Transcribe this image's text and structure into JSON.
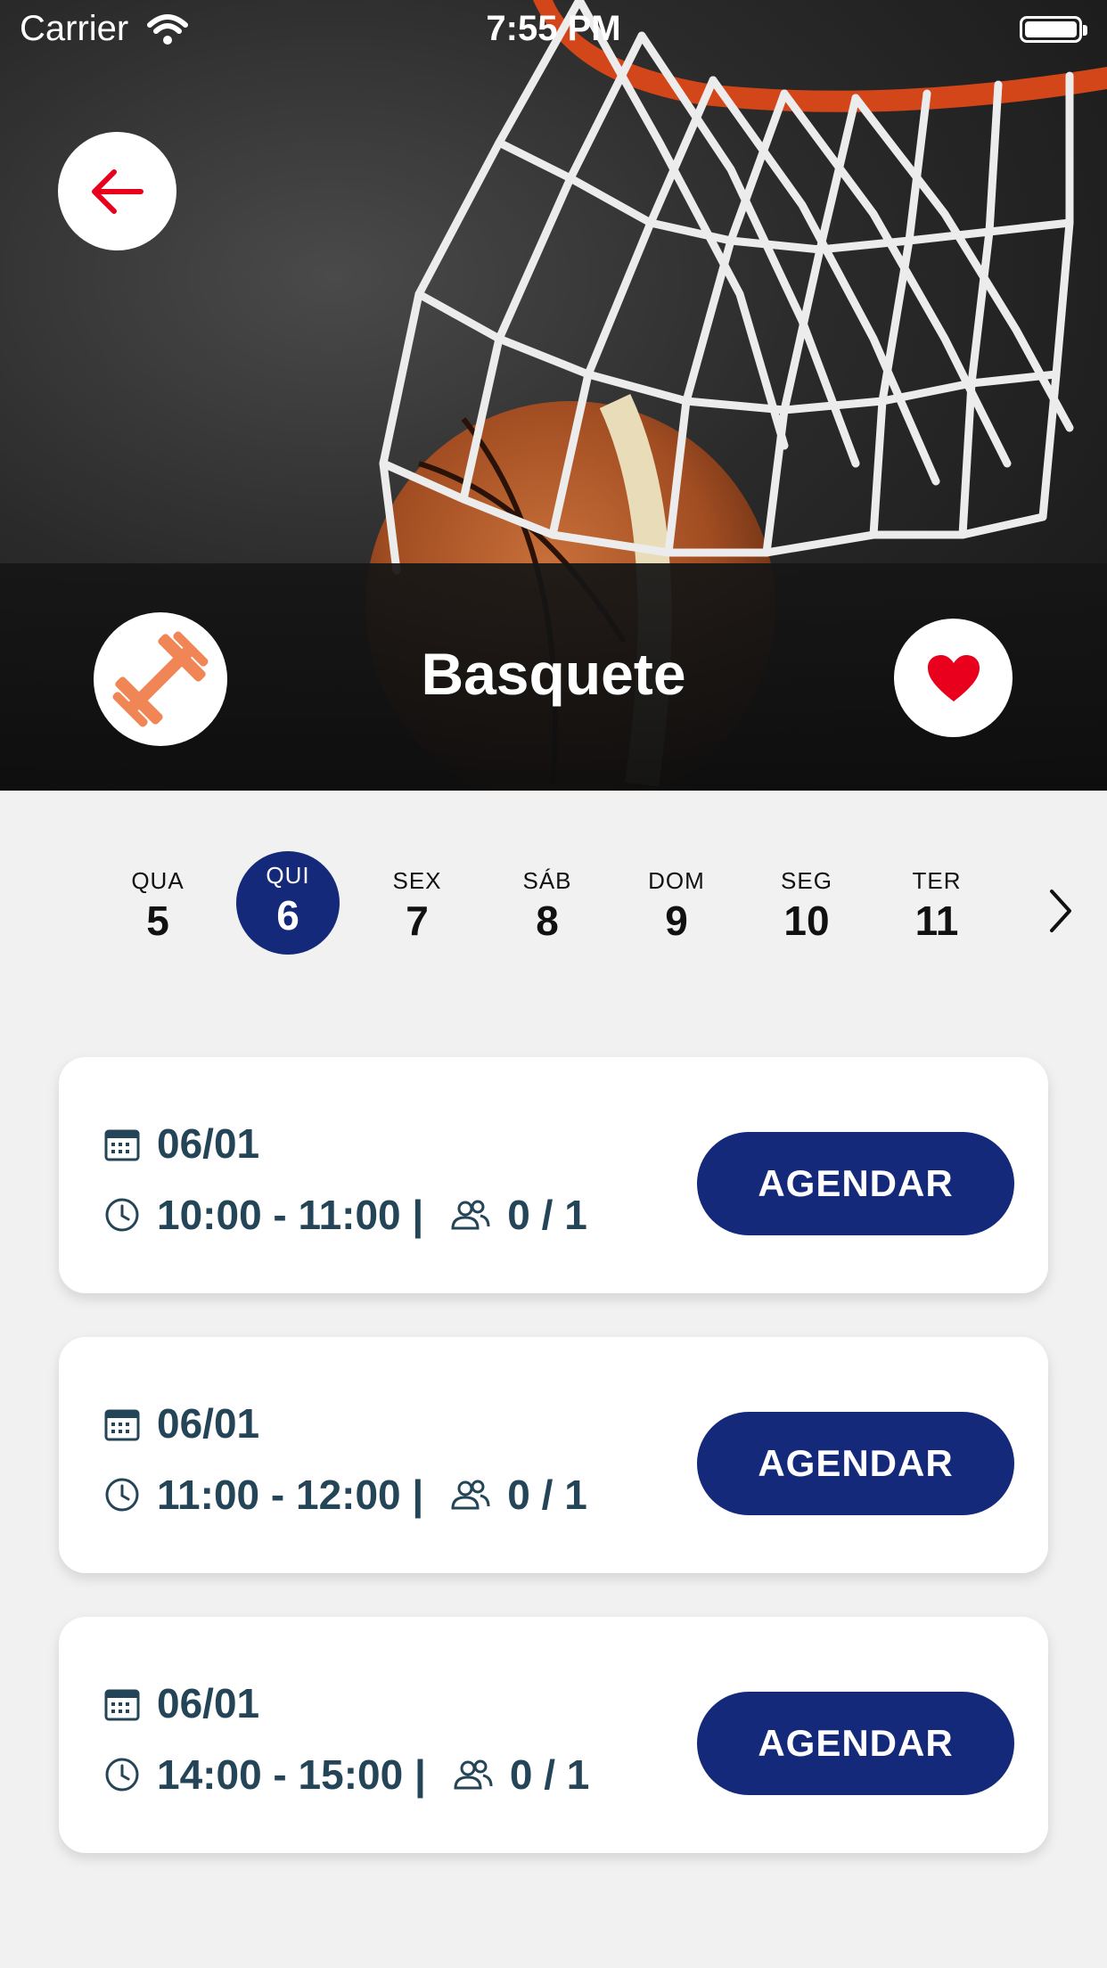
{
  "status_bar": {
    "carrier": "Carrier",
    "time": "7:55 PM"
  },
  "header": {
    "title": "Basquete",
    "sport_icon": "dumbbell-icon",
    "favorite_icon": "heart-icon",
    "back_icon": "arrow-left-icon"
  },
  "colors": {
    "primary": "#14297a",
    "accent_orange": "#f08556",
    "heart_red": "#e8001c",
    "text_dark": "#234557"
  },
  "days": [
    {
      "name": "QUA",
      "num": "5"
    },
    {
      "name": "QUI",
      "num": "6",
      "selected": true
    },
    {
      "name": "SEX",
      "num": "7"
    },
    {
      "name": "SÁB",
      "num": "8"
    },
    {
      "name": "DOM",
      "num": "9"
    },
    {
      "name": "SEG",
      "num": "10"
    },
    {
      "name": "TER",
      "num": "11"
    }
  ],
  "slots": [
    {
      "date": "06/01",
      "time": "10:00 - 11:00 |",
      "capacity": "0 / 1",
      "button": "AGENDAR"
    },
    {
      "date": "06/01",
      "time": "11:00 - 12:00 |",
      "capacity": "0 / 1",
      "button": "AGENDAR"
    },
    {
      "date": "06/01",
      "time": "14:00 - 15:00 |",
      "capacity": "0 / 1",
      "button": "AGENDAR"
    }
  ]
}
